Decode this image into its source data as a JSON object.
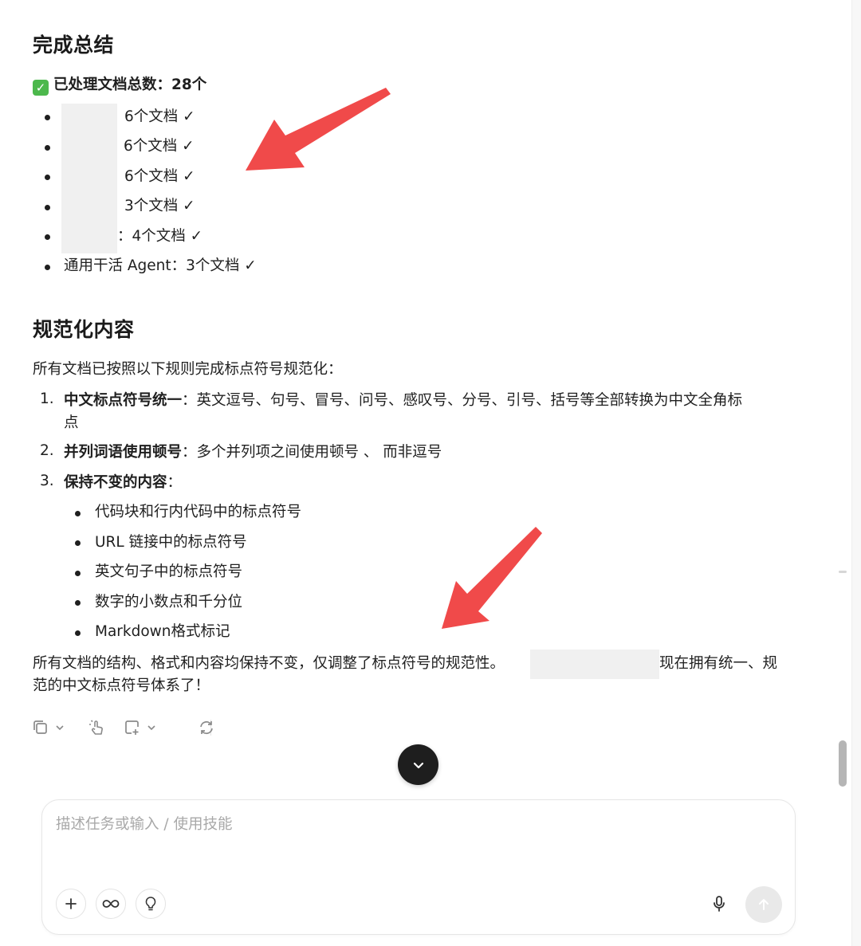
{
  "summary": {
    "heading": "完成总结",
    "total_label": "已处理文档总数：28个",
    "items": [
      {
        "text": "6个文档 ✓"
      },
      {
        "text": "6个文档 ✓"
      },
      {
        "text": "6个文档 ✓"
      },
      {
        "text": "3个文档 ✓"
      },
      {
        "text": "：4个文档 ✓"
      },
      {
        "text": "通用干活 Agent：3个文档 ✓"
      }
    ]
  },
  "normalize": {
    "heading": "规范化内容",
    "intro": "所有文档已按照以下规则完成标点符号规范化：",
    "rules": [
      {
        "num": "1.",
        "title": "中文标点符号统一",
        "text_line1": "：英文逗号、句号、冒号、问号、感叹号、分号、引号、括号等全部转换为中文全角标",
        "text_line2": "点"
      },
      {
        "num": "2.",
        "title": "并列词语使用顿号",
        "text_line1": "：多个并列项之间使用顿号 、 而非逗号"
      },
      {
        "num": "3.",
        "title": "保持不变的内容",
        "text_line1": "："
      }
    ],
    "keep_items": [
      "代码块和行内代码中的标点符号",
      "URL 链接中的标点符号",
      "英文句子中的标点符号",
      "数字的小数点和千分位",
      "Markdown格式标记"
    ],
    "closing_line1_a": "所有文档的结构、格式和内容均保持不变，仅调整了标点符号的规范性。",
    "closing_line1_b": "现在拥有统一、规",
    "closing_line2": "范的中文标点符号体系了！"
  },
  "toolbar": {
    "copy_icon": "copy-icon",
    "tap_icon": "tap-icon",
    "add_icon": "add-to-icon",
    "regen_icon": "regenerate-icon"
  },
  "composer": {
    "placeholder": "描述任务或输入 / 使用技能",
    "value": ""
  },
  "colors": {
    "arrow": "#f04a4a",
    "scroll_button": "#1e1e1e"
  }
}
